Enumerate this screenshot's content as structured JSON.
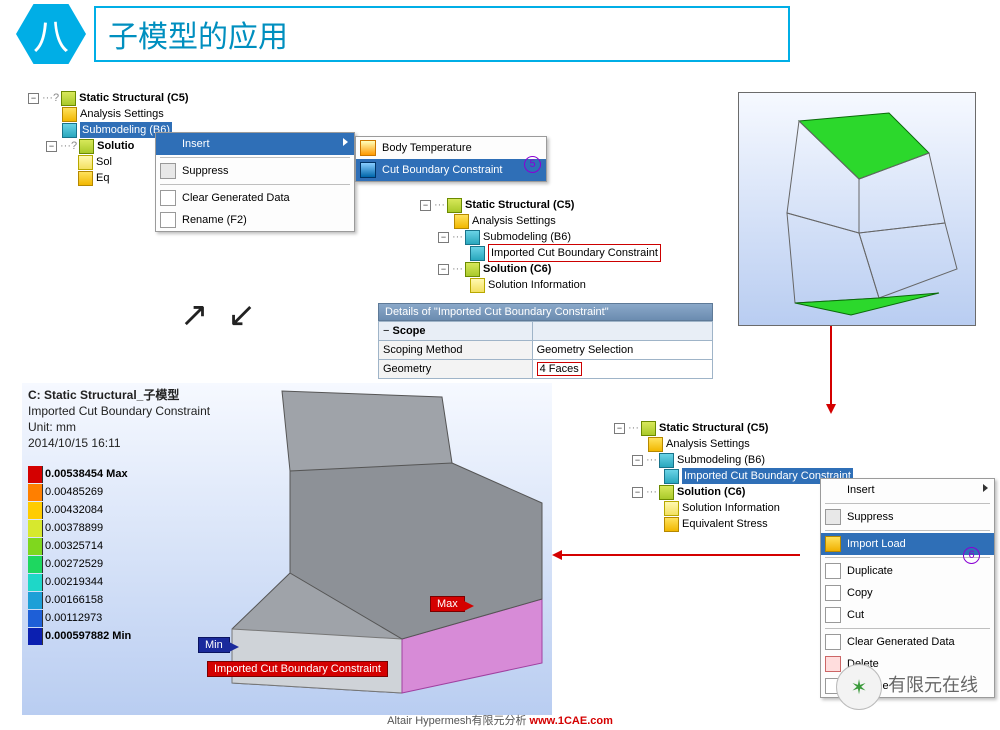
{
  "header": {
    "badge": "八",
    "title": "子模型的应用"
  },
  "tree1": {
    "root": "Static Structural (C5)",
    "items": [
      "Analysis Settings",
      "Submodeling (B6)",
      "Solutio",
      "Sol",
      "Eq"
    ]
  },
  "menu1": {
    "insert": "Insert",
    "items": [
      "Suppress",
      "Clear Generated Data",
      "Rename (F2)"
    ],
    "sub": {
      "body_temp": "Body Temperature",
      "cut_boundary": "Cut Boundary Constraint"
    }
  },
  "badges": {
    "five": "5",
    "six": "6"
  },
  "tree2": {
    "root": "Static Structural (C5)",
    "items": [
      "Analysis Settings",
      "Submodeling (B6)",
      "Imported Cut Boundary Constraint",
      "Solution (C6)",
      "Solution Information"
    ]
  },
  "details": {
    "title": "Details of \"Imported Cut Boundary Constraint\"",
    "scope": "Scope",
    "rows": [
      {
        "k": "Scoping Method",
        "v": "Geometry Selection"
      },
      {
        "k": "Geometry",
        "v": "4 Faces"
      }
    ]
  },
  "tree3": {
    "root": "Static Structural (C5)",
    "items": [
      "Analysis Settings",
      "Submodeling (B6)",
      "Imported Cut Boundary Constraint",
      "Solution (C6)",
      "Solution Information",
      "Equivalent Stress"
    ]
  },
  "menu2": {
    "items": [
      "Insert",
      "Suppress",
      "Import Load",
      "Duplicate",
      "Copy",
      "Cut",
      "Clear Generated Data",
      "Delete",
      "Rename"
    ]
  },
  "result": {
    "title": "C: Static Structural_子模型",
    "subtitle": "Imported Cut Boundary Constraint",
    "unit": "Unit: mm",
    "timestamp": "2014/10/15 16:11",
    "min_label": "Min",
    "max_label": "Max",
    "icc_label": "Imported Cut Boundary Constraint",
    "legend": [
      {
        "c": "#d40000",
        "v": "0.00538454 Max",
        "b": true
      },
      {
        "c": "#ff7f00",
        "v": "0.00485269"
      },
      {
        "c": "#ffcc00",
        "v": "0.00432084"
      },
      {
        "c": "#d7e82e",
        "v": "0.00378899"
      },
      {
        "c": "#7fd71e",
        "v": "0.00325714"
      },
      {
        "c": "#1ed760",
        "v": "0.00272529"
      },
      {
        "c": "#1ed7c8",
        "v": "0.00219344"
      },
      {
        "c": "#1e9fd7",
        "v": "0.00166158"
      },
      {
        "c": "#1e5fd7",
        "v": "0.00112973"
      },
      {
        "c": "#0b1fb0",
        "v": "0.000597882 Min",
        "b": true
      }
    ]
  },
  "footer": {
    "text1": "Altair Hypermesh有限元分析 ",
    "link": "www.1CAE.com"
  },
  "watermark": "有限元在线"
}
